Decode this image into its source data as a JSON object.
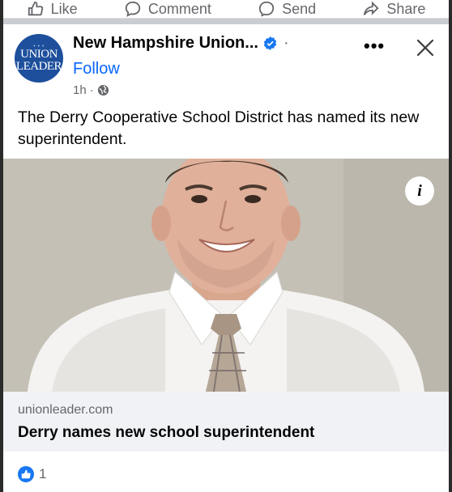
{
  "actions": {
    "like_label": "Like",
    "comment_label": "Comment",
    "send_label": "Send",
    "share_label": "Share"
  },
  "post": {
    "avatar_line1": "UNION",
    "avatar_line2": "LEADER",
    "page_name": "New Hampshire Union...",
    "separator": "·",
    "follow_label": "Follow",
    "time": "1h",
    "time_separator": "·",
    "more_label": "•••",
    "text": "The Derry Cooperative School District has named its new superintendent.",
    "info_label": "i"
  },
  "link": {
    "domain": "unionleader.com",
    "title": "Derry names new school superintendent"
  },
  "reactions": {
    "count": "1"
  },
  "colors": {
    "brand_blue": "#1d4f9c",
    "facebook_blue": "#0866ff",
    "like_blue": "#1877f2"
  }
}
